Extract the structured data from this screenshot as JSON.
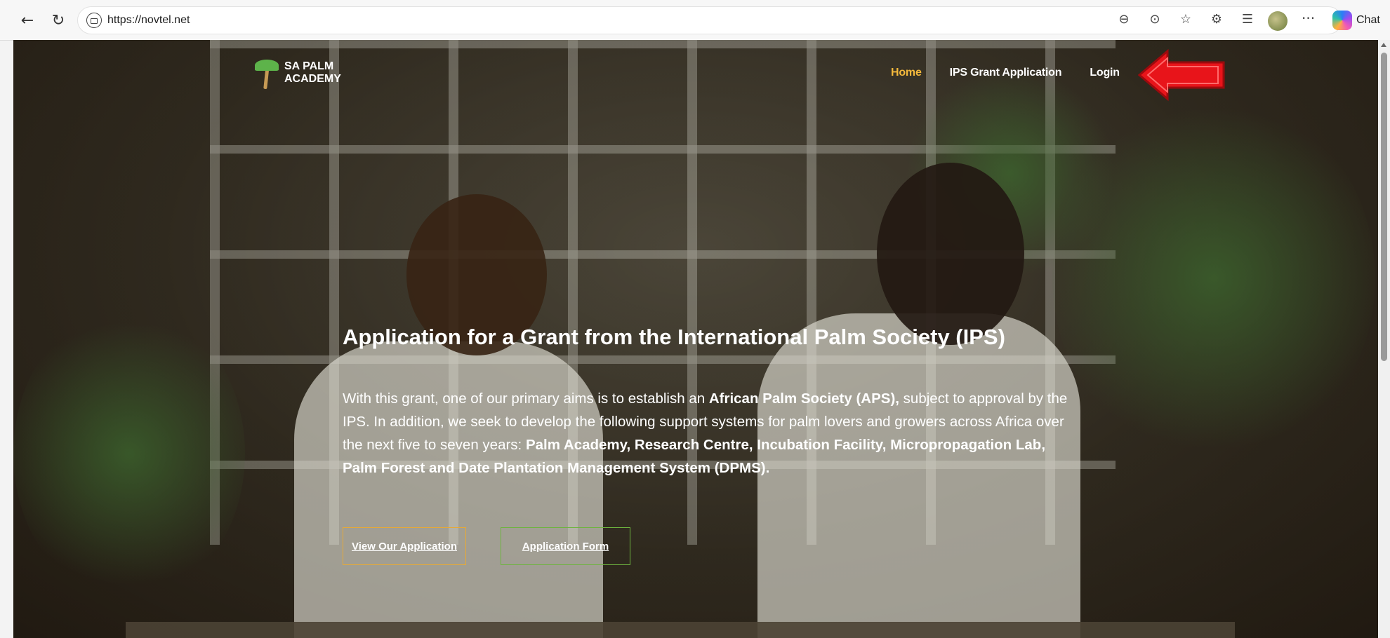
{
  "browser": {
    "url": "https://novtel.net",
    "back_icon": "←",
    "refresh_icon": "↻",
    "url_icons": [
      "zoom-out-icon",
      "reading-icon",
      "favorite-star-icon",
      "extensions-icon",
      "favorites-list-icon"
    ],
    "more_label": "···",
    "chat_label": "Chat"
  },
  "site": {
    "logo_line1": "SA PALM",
    "logo_line2": "ACADEMY",
    "nav": {
      "home": "Home",
      "grant": "IPS Grant Application",
      "login": "Login"
    }
  },
  "hero": {
    "title": "Application for a Grant from the International Palm Society (IPS)",
    "p1": "With this grant, one of our primary aims is to establish an ",
    "p1_bold": "African Palm Society (APS),",
    "p2": " subject to approval by the IPS. In addition, we seek to develop the following support systems for palm lovers and growers across Africa over the next five to seven years: ",
    "p2_bold": "Palm Academy, Research Centre, Incubation Facility, Micropropagation Lab, Palm Forest and Date Plantation Management System (DPMS).",
    "btn_view": "View Our Application",
    "btn_form": "Application Form"
  },
  "colors": {
    "nav_active": "#f4b93c",
    "btn_view_border": "#e6a937",
    "btn_form_border": "#6eb43f",
    "annotation_arrow": "#e8141a"
  }
}
